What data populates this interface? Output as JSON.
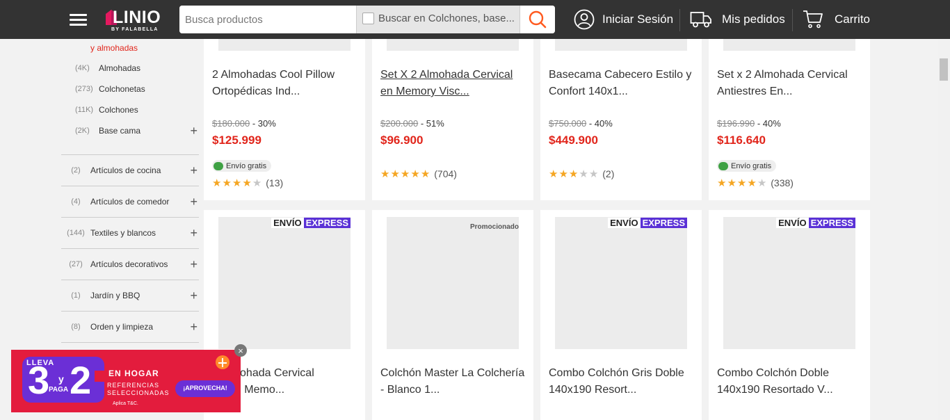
{
  "header": {
    "logo_main": "LINIO",
    "logo_sub": "BY FALABELLA",
    "search_placeholder": "Busca productos",
    "scope_label": "Buscar en Colchones, base...",
    "login_label": "Iniciar Sesión",
    "orders_label": "Mis pedidos",
    "cart_label": "Carrito",
    "icons": [
      "menu-icon",
      "search-icon",
      "user-icon",
      "truck-icon",
      "cart-icon"
    ],
    "colors": {
      "bar": "#333333",
      "accent": "#ff5a1f"
    }
  },
  "sidebar": {
    "current": "y almohadas",
    "subitems": [
      {
        "count": "(4K)",
        "name": "Almohadas",
        "expandable": false
      },
      {
        "count": "(273)",
        "name": "Colchonetas",
        "expandable": false
      },
      {
        "count": "(11K)",
        "name": "Colchones",
        "expandable": false
      },
      {
        "count": "(2K)",
        "name": "Base cama",
        "expandable": true,
        "plus": "+"
      }
    ],
    "categories": [
      {
        "count": "(2)",
        "name": "Artículos de cocina",
        "plus": "+"
      },
      {
        "count": "(4)",
        "name": "Artículos de comedor",
        "plus": "+"
      },
      {
        "count": "(144)",
        "name": "Textiles y blancos",
        "plus": "+"
      },
      {
        "count": "(27)",
        "name": "Artículos decorativos",
        "plus": "+"
      },
      {
        "count": "(1)",
        "name": "Jardín y BBQ",
        "plus": "+"
      },
      {
        "count": "(8)",
        "name": "Orden y limpieza",
        "plus": "+"
      }
    ]
  },
  "products_row1": [
    {
      "title_line1": "2 Almohadas Cool Pillow",
      "title_line2": "Ortopédicas Ind...",
      "old_price": "$180.000",
      "discount": "- 30%",
      "price": "$125.999",
      "shipping": "Envío gratis",
      "stars": 4,
      "reviews": "(13)"
    },
    {
      "title_line1": "Set X 2 Almohada Cervical",
      "title_line2": "en Memory Visc...",
      "old_price": "$200.000",
      "discount": "- 51%",
      "price": "$96.900",
      "shipping": "",
      "stars": 5,
      "reviews": "(704)"
    },
    {
      "title_line1": "Basecama Cabecero Estilo y",
      "title_line2": "Confort 140x1...",
      "old_price": "$750.000",
      "discount": "- 40%",
      "price": "$449.900",
      "shipping": "",
      "stars": 3,
      "reviews": "(2)"
    },
    {
      "title_line1": "Set x 2 Almohada Cervical",
      "title_line2": "Antiestres En...",
      "old_price": "$196.990",
      "discount": "- 40%",
      "price": "$116.640",
      "shipping": "Envío gratis",
      "stars": 4,
      "reviews": "(338)"
    }
  ],
  "products_row2": [
    {
      "badge_a": "ENVÍO",
      "badge_b": "EXPRESS",
      "title_line1": "2 Almohada Cervical",
      "title_line2": "oo En Memo..."
    },
    {
      "promo": "Promocionado",
      "title_line1": "Colchón Master La Colchería",
      "title_line2": "- Blanco 1..."
    },
    {
      "badge_a": "ENVÍO",
      "badge_b": "EXPRESS",
      "title_line1": "Combo Colchón Gris Doble",
      "title_line2": "140x190 Resort..."
    },
    {
      "badge_a": "ENVÍO",
      "badge_b": "EXPRESS",
      "title_line1": "Combo Colchón Doble",
      "title_line2": "140x190 Resortado V..."
    }
  ],
  "banner": {
    "lleva": "LLEVA",
    "three": "3",
    "y": "y",
    "paga": "PAGA",
    "two": "2",
    "headline": "EN HOGAR",
    "line1": "REFERENCIAS",
    "line2": "SELECCIONADAS",
    "cta": "¡APROVECHA!",
    "terms": "Aplica T&C.",
    "close": "×"
  }
}
